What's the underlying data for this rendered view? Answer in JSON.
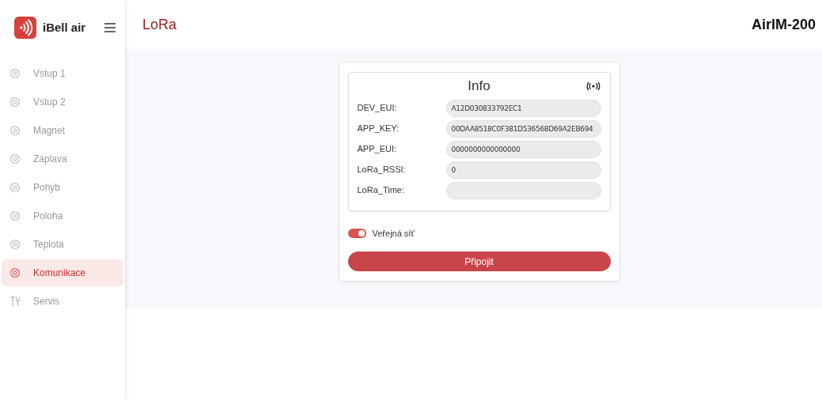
{
  "brand": {
    "name": "iBell air"
  },
  "sidebar": {
    "items": [
      {
        "label": "Vstup 1",
        "kind": "gear",
        "selected": false
      },
      {
        "label": "Vstup 2",
        "kind": "gear",
        "selected": false
      },
      {
        "label": "Magnet",
        "kind": "gear",
        "selected": false
      },
      {
        "label": "Záplava",
        "kind": "gear",
        "selected": false
      },
      {
        "label": "Pohyb",
        "kind": "gear",
        "selected": false
      },
      {
        "label": "Poloha",
        "kind": "gear",
        "selected": false
      },
      {
        "label": "Teplota",
        "kind": "gear",
        "selected": false
      },
      {
        "label": "Komunikace",
        "kind": "gear",
        "selected": true
      },
      {
        "label": "Servis",
        "kind": "tools",
        "selected": false
      }
    ]
  },
  "header": {
    "title": "LoRa",
    "device": "AirIM-200"
  },
  "info": {
    "title": "Info",
    "fields": [
      {
        "label": "DEV_EUI:",
        "value": "A12D030833792EC1"
      },
      {
        "label": "APP_KEY:",
        "value": "00DAA8518C0F381D536568D69A2EB694"
      },
      {
        "label": "APP_EUI:",
        "value": "0000000000000000"
      },
      {
        "label": "LoRa_RSSI:",
        "value": "0"
      },
      {
        "label": "LoRa_Time:"
      }
    ]
  },
  "public_network": {
    "label": "Veřejná síť",
    "on": true
  },
  "connect_button": "Připojit"
}
